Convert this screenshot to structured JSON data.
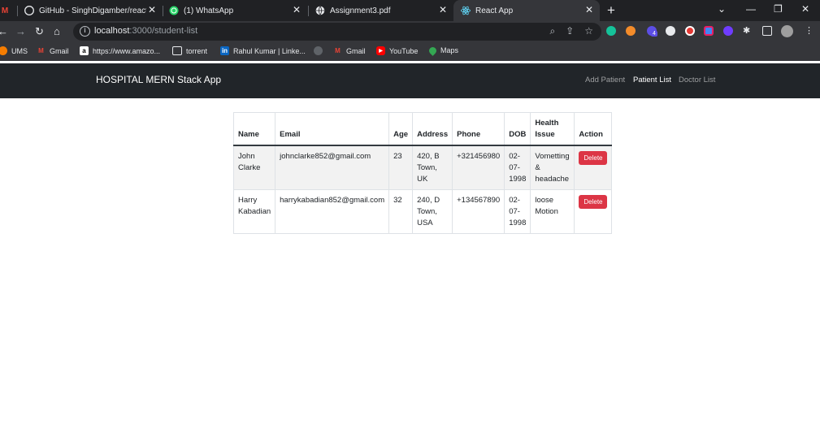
{
  "browser": {
    "tabs": [
      {
        "title": "GitHub - SinghDigamber/react-m",
        "icon": "github-icon"
      },
      {
        "title": "(1) WhatsApp",
        "icon": "whatsapp-icon"
      },
      {
        "title": "Assignment3.pdf",
        "icon": "globe-icon"
      },
      {
        "title": "React App",
        "icon": "react-icon",
        "active": true
      }
    ],
    "url": {
      "host": "localhost",
      "path": ":3000/student-list"
    },
    "bookmarks": [
      {
        "label": "UMS"
      },
      {
        "label": "Gmail"
      },
      {
        "label": "https://www.amazo..."
      },
      {
        "label": "torrent"
      },
      {
        "label": "Rahul Kumar | Linke..."
      },
      {
        "label": ""
      },
      {
        "label": "Gmail"
      },
      {
        "label": "YouTube"
      },
      {
        "label": "Maps"
      }
    ],
    "extension_badge": "4"
  },
  "app": {
    "brand": "HOSPITAL MERN Stack App",
    "nav": {
      "add_patient": "Add Patient",
      "patient_list": "Patient List",
      "doctor_list": "Doctor List"
    }
  },
  "table": {
    "headers": {
      "name": "Name",
      "email": "Email",
      "age": "Age",
      "address": "Address",
      "phone": "Phone",
      "dob": "DOB",
      "health_issue": "Health Issue",
      "action": "Action"
    },
    "rows": [
      {
        "name": "John Clarke",
        "email": "johnclarke852@gmail.com",
        "age": "23",
        "address": "420, B Town, UK",
        "phone": "+321456980",
        "dob": "02-07-1998",
        "health_issue": "Vometting & headache",
        "action": "Delete"
      },
      {
        "name": "Harry Kabadian",
        "email": "harrykabadian852@gmail.com",
        "age": "32",
        "address": "240, D Town, USA",
        "phone": "+134567890",
        "dob": "02-07-1998",
        "health_issue": "loose Motion",
        "action": "Delete"
      }
    ]
  },
  "colors": {
    "navbar_bg": "#212529",
    "delete_btn": "#dc3545",
    "browser_dark": "#202124"
  }
}
